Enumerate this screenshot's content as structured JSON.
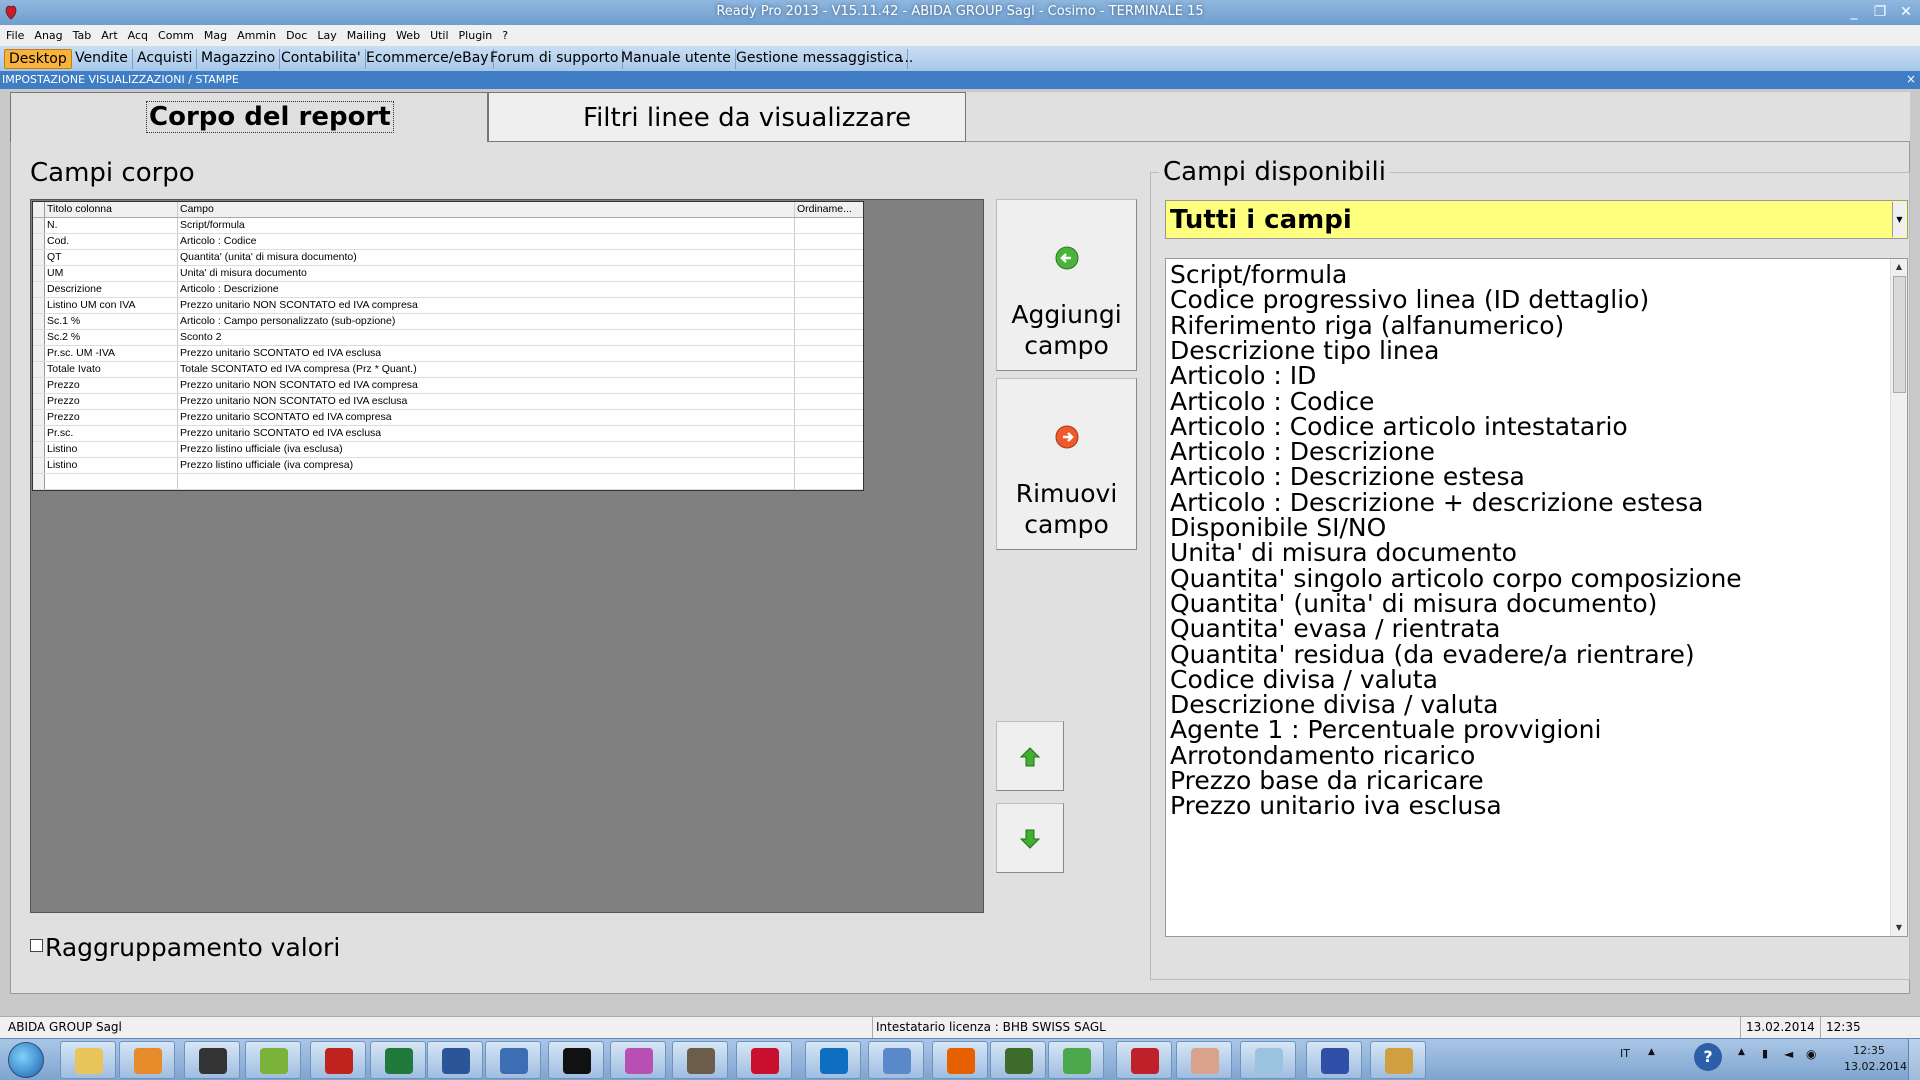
{
  "window": {
    "title": "Ready Pro 2013 - V15.11.42 - ABIDA GROUP Sagl - Cosimo - TERMINALE 15",
    "controls": [
      "_",
      "❐",
      "✕"
    ]
  },
  "menu": [
    "File",
    "Anag",
    "Tab",
    "Art",
    "Acq",
    "Comm",
    "Mag",
    "Ammin",
    "Doc",
    "Lay",
    "Mailing",
    "Web",
    "Util",
    "Plugin",
    "?"
  ],
  "app_tabs": [
    {
      "label": "Desktop",
      "active": true
    },
    {
      "label": "Vendite"
    },
    {
      "label": "Acquisti"
    },
    {
      "label": "Magazzino"
    },
    {
      "label": "Contabilita'"
    },
    {
      "label": "Ecommerce/eBay"
    },
    {
      "label": "Forum di supporto"
    },
    {
      "label": "Manuale utente"
    },
    {
      "label": "Gestione messaggistica"
    },
    {
      "label": "..."
    }
  ],
  "section": {
    "title": "IMPOSTAZIONE VISUALIZZAZIONI / STAMPE",
    "close": "×"
  },
  "page_tabs": [
    {
      "label": "Corpo del report",
      "active": true
    },
    {
      "label": "Filtri linee da visualizzare"
    }
  ],
  "left": {
    "heading": "Campi corpo",
    "grid": {
      "columns": [
        "Titolo colonna",
        "Campo",
        "Ordiname..."
      ],
      "rows": [
        [
          "N.",
          "Script/formula",
          ""
        ],
        [
          "Cod.",
          "Articolo : Codice",
          ""
        ],
        [
          "QT",
          "Quantita' (unita' di misura documento)",
          ""
        ],
        [
          "UM",
          "Unita' di misura documento",
          ""
        ],
        [
          "Descrizione",
          "Articolo : Descrizione",
          ""
        ],
        [
          "Listino UM con IVA",
          "Prezzo unitario NON SCONTATO ed IVA compresa",
          ""
        ],
        [
          "Sc.1 %",
          "Articolo : Campo personalizzato (sub-opzione)",
          ""
        ],
        [
          "Sc.2 %",
          "Sconto 2",
          ""
        ],
        [
          "Pr.sc. UM -IVA",
          "Prezzo unitario SCONTATO ed IVA esclusa",
          ""
        ],
        [
          "Totale Ivato",
          "Totale SCONTATO ed IVA compresa (Prz * Quant.)",
          ""
        ],
        [
          "Prezzo",
          "Prezzo unitario NON SCONTATO ed IVA compresa",
          ""
        ],
        [
          "Prezzo",
          "Prezzo unitario NON SCONTATO ed IVA esclusa",
          ""
        ],
        [
          "Prezzo",
          "Prezzo unitario SCONTATO ed IVA compresa",
          ""
        ],
        [
          "Pr.sc.",
          "Prezzo unitario SCONTATO ed IVA esclusa",
          ""
        ],
        [
          "Listino",
          "Prezzo listino ufficiale (iva esclusa)",
          ""
        ],
        [
          "Listino",
          "Prezzo listino ufficiale (iva compresa)",
          ""
        ],
        [
          "",
          "",
          ""
        ]
      ]
    },
    "checkbox": {
      "label": "Raggruppamento valori",
      "checked": false
    }
  },
  "buttons": {
    "add": {
      "line1": "Aggiungi",
      "line2": "campo",
      "icon": "arrow-left-green-icon"
    },
    "remove": {
      "line1": "Rimuovi",
      "line2": "campo",
      "icon": "arrow-right-red-icon"
    },
    "move_up": {
      "icon": "arrow-up-green-icon"
    },
    "move_down": {
      "icon": "arrow-down-green-icon"
    }
  },
  "right": {
    "heading": "Campi disponibili",
    "filter": {
      "value": "Tutti i campi",
      "color": "#ffff7f"
    },
    "items": [
      "Script/formula",
      "Codice progressivo linea (ID dettaglio)",
      "Riferimento riga (alfanumerico)",
      "Descrizione tipo linea",
      "Articolo : ID",
      "Articolo : Codice",
      "Articolo : Codice articolo intestatario",
      "Articolo : Descrizione",
      "Articolo : Descrizione estesa",
      "Articolo : Descrizione + descrizione estesa",
      "Disponibile SI/NO",
      "Unita' di misura documento",
      "Quantita' singolo articolo corpo composizione",
      "Quantita' (unita' di misura documento)",
      "Quantita' evasa / rientrata",
      "Quantita' residua (da evadere/a rientrare)",
      "Codice divisa / valuta",
      "Descrizione divisa / valuta",
      "Agente 1 : Percentuale provvigioni",
      "Arrotondamento ricarico",
      "Prezzo base da ricaricare",
      "Prezzo unitario iva esclusa"
    ]
  },
  "status": {
    "company": "ABIDA GROUP Sagl",
    "license": "Intestatario licenza : BHB SWISS SAGL",
    "date": "13.02.2014",
    "time": "12:35"
  },
  "taskbar": {
    "apps": [
      {
        "name": "explorer-icon",
        "color": "#e8c45a"
      },
      {
        "name": "media-player-icon",
        "color": "#e78b2a"
      },
      {
        "name": "hp-icon",
        "color": "#333333"
      },
      {
        "name": "green-app-icon",
        "color": "#7bb23a"
      },
      {
        "name": "filezilla-icon",
        "color": "#c0231d"
      },
      {
        "name": "excel-icon",
        "color": "#1f7a3c"
      },
      {
        "name": "word-icon",
        "color": "#2a5699"
      },
      {
        "name": "network-icon",
        "color": "#3d6eb4"
      },
      {
        "name": "pm-icon",
        "color": "#111111"
      },
      {
        "name": "picasa-icon",
        "color": "#b84fb5"
      },
      {
        "name": "gimp-icon",
        "color": "#6b5d4a"
      },
      {
        "name": "acrobat-icon",
        "color": "#c8102e"
      },
      {
        "name": "teamviewer-icon",
        "color": "#0e6ec1"
      },
      {
        "name": "control-panel-icon",
        "color": "#5a88c8"
      },
      {
        "name": "firefox-icon",
        "color": "#e66000"
      },
      {
        "name": "terminal-icon",
        "color": "#3c6b2a"
      },
      {
        "name": "chrome-icon",
        "color": "#4aa84a"
      },
      {
        "name": "readypro-icon",
        "color": "#c0202a"
      },
      {
        "name": "eraser-icon",
        "color": "#d9a28a"
      },
      {
        "name": "notepad-icon",
        "color": "#9ac3e0"
      },
      {
        "name": "skype-like-icon",
        "color": "#2f4fa8"
      },
      {
        "name": "paint-icon",
        "color": "#d0a040"
      }
    ],
    "tray_lang": "IT",
    "clock_time": "12:35",
    "clock_date": "13.02.2014"
  }
}
